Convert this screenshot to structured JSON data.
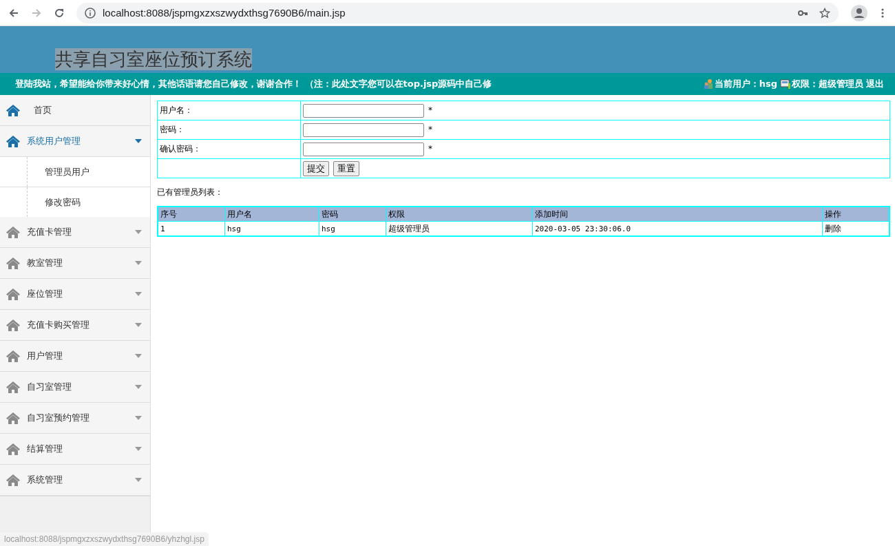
{
  "browser": {
    "url": "localhost:8088/jspmgxzxszwydxthsg7690B6/main.jsp"
  },
  "header": {
    "title": "共享自习室座位预订系统"
  },
  "notice_bar": {
    "marquee": "登陆我站，希望能给你带来好心情，其他话语请您自己修改，谢谢合作！ （注：此处文字您可以在top.jsp源码中自己修",
    "user_label": "当前用户：hsg",
    "role_label": "权限：超级管理员",
    "logout": "退出"
  },
  "sidebar": {
    "items": [
      {
        "kind": "link",
        "label": "首页"
      },
      {
        "kind": "group",
        "label": "系统用户管理",
        "expanded": true,
        "children": [
          {
            "label": "管理员用户"
          },
          {
            "label": "修改密码"
          }
        ]
      },
      {
        "kind": "group",
        "label": "充值卡管理",
        "expanded": false
      },
      {
        "kind": "group",
        "label": "教室管理",
        "expanded": false
      },
      {
        "kind": "group",
        "label": "座位管理",
        "expanded": false
      },
      {
        "kind": "group",
        "label": "充值卡购买管理",
        "expanded": false
      },
      {
        "kind": "group",
        "label": "用户管理",
        "expanded": false
      },
      {
        "kind": "group",
        "label": "自习室管理",
        "expanded": false
      },
      {
        "kind": "group",
        "label": "自习室预约管理",
        "expanded": false
      },
      {
        "kind": "group",
        "label": "结算管理",
        "expanded": false
      },
      {
        "kind": "group",
        "label": "系统管理",
        "expanded": false
      }
    ]
  },
  "form": {
    "fields": [
      {
        "label": "用户名：",
        "required_mark": "*"
      },
      {
        "label": "密码：",
        "required_mark": "*"
      },
      {
        "label": "确认密码：",
        "required_mark": "*"
      }
    ],
    "buttons": [
      "提交",
      "重置"
    ]
  },
  "list_title": "已有管理员列表：",
  "table": {
    "columns": [
      "序号",
      "用户名",
      "密码",
      "权限",
      "添加时间",
      "操作"
    ],
    "rows": [
      [
        "1",
        "hsg",
        "hsg",
        "超级管理员",
        "2020-03-05 23:30:06.0",
        "删除"
      ]
    ]
  },
  "status_url": "localhost:8088/jspmgxzxszwydxthsg7690B6/yhzhgl.jsp"
}
